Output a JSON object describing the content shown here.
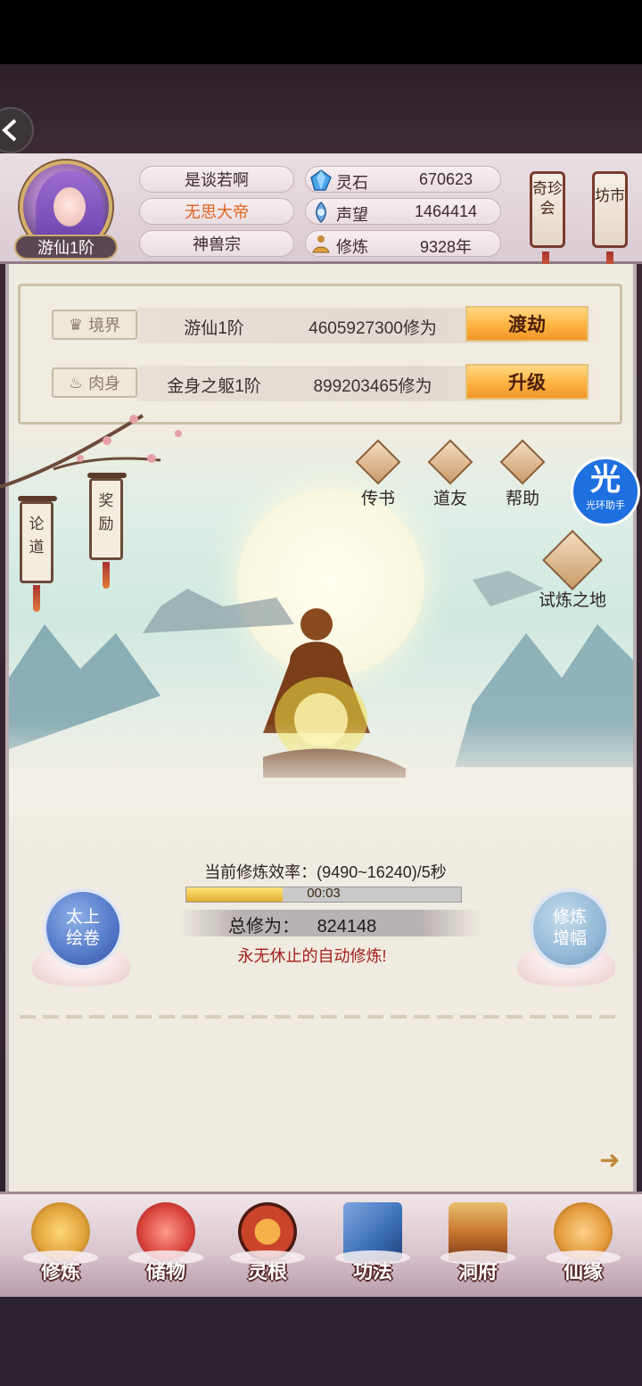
{
  "player": {
    "name": "是谈若啊",
    "title": "无思大帝",
    "sect": "神兽宗",
    "rank": "游仙1阶"
  },
  "resources": [
    {
      "icon": "spirit-stone-icon",
      "label": "灵石",
      "value": "670623"
    },
    {
      "icon": "reputation-icon",
      "label": "声望",
      "value": "1464414"
    },
    {
      "icon": "cultivation-icon",
      "label": "修炼",
      "value": "9328年"
    }
  ],
  "side_tabs": {
    "treasure": "奇珍会",
    "market": "坊市"
  },
  "stats": {
    "realm": {
      "label": "境界",
      "name": "游仙1阶",
      "value": "4605927300修为",
      "button": "渡劫"
    },
    "body": {
      "label": "肉身",
      "name": "金身之躯1阶",
      "value": "899203465修为",
      "button": "升级"
    }
  },
  "quick_actions": [
    {
      "label": "传书",
      "icon": "letter-icon"
    },
    {
      "label": "道友",
      "icon": "friend-icon"
    },
    {
      "label": "帮助",
      "icon": "help-icon"
    }
  ],
  "assistant_badge": {
    "glyph": "光",
    "label": "光环助手"
  },
  "trial": {
    "label": "试炼之地"
  },
  "banners": {
    "discuss": "论道",
    "reward": "奖励"
  },
  "cultivation": {
    "rate_label": "当前修炼效率：(9490~16240)/5秒",
    "timer": "00:03",
    "progress": 0.35,
    "total_label": "总修为：",
    "total_value": "824148",
    "auto_text": "永无休止的自动修炼!"
  },
  "left_ring": "太上\n绘卷",
  "right_ring": "修炼\n增幅",
  "nav": [
    {
      "label": "修炼",
      "icon": "meditate-icon",
      "color": "#e0a13a"
    },
    {
      "label": "储物",
      "icon": "bag-icon",
      "color": "#d9433b"
    },
    {
      "label": "灵根",
      "icon": "spirit-root-icon",
      "color": "#c9442a"
    },
    {
      "label": "功法",
      "icon": "book-icon",
      "color": "#3a6fb5"
    },
    {
      "label": "洞府",
      "icon": "cave-house-icon",
      "color": "#c9772f"
    },
    {
      "label": "仙缘",
      "icon": "gourd-icon",
      "color": "#e29a3a"
    }
  ]
}
